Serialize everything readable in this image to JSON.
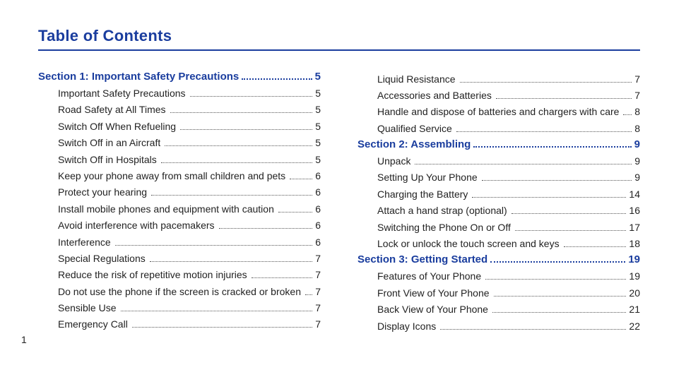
{
  "title": "Table of Contents",
  "pageNumber": "1",
  "columns": [
    [
      {
        "type": "section",
        "label": "Section 1:  Important Safety Precautions",
        "page": "5"
      },
      {
        "type": "entry",
        "label": "Important Safety Precautions",
        "page": "5"
      },
      {
        "type": "entry",
        "label": "Road Safety at All Times",
        "page": "5"
      },
      {
        "type": "entry",
        "label": "Switch Off When Refueling",
        "page": "5"
      },
      {
        "type": "entry",
        "label": "Switch Off in an Aircraft",
        "page": "5"
      },
      {
        "type": "entry",
        "label": "Switch Off in Hospitals",
        "page": "5"
      },
      {
        "type": "entry",
        "label": "Keep your phone away from small children and pets",
        "page": "6"
      },
      {
        "type": "entry",
        "label": "Protect your hearing",
        "page": "6"
      },
      {
        "type": "entry",
        "label": "Install mobile phones and equipment with caution",
        "page": "6"
      },
      {
        "type": "entry",
        "label": "Avoid interference with pacemakers",
        "page": "6"
      },
      {
        "type": "entry",
        "label": "Interference",
        "page": "6"
      },
      {
        "type": "entry",
        "label": "Special Regulations",
        "page": "7"
      },
      {
        "type": "entry",
        "label": "Reduce the risk of repetitive motion injuries",
        "page": "7"
      },
      {
        "type": "entry",
        "label": "Do not use the phone if the screen is cracked or broken",
        "page": "7"
      },
      {
        "type": "entry",
        "label": "Sensible Use",
        "page": "7"
      },
      {
        "type": "entry",
        "label": "Emergency Call",
        "page": "7"
      }
    ],
    [
      {
        "type": "entry",
        "label": "Liquid Resistance",
        "page": "7"
      },
      {
        "type": "entry",
        "label": "Accessories and Batteries",
        "page": "7"
      },
      {
        "type": "entry",
        "label": "Handle and dispose of batteries and chargers with care",
        "page": "8"
      },
      {
        "type": "entry",
        "label": "Qualified Service",
        "page": "8"
      },
      {
        "type": "section",
        "label": "Section 2:  Assembling",
        "page": "9"
      },
      {
        "type": "entry",
        "label": "Unpack",
        "page": "9"
      },
      {
        "type": "entry",
        "label": "Setting Up Your Phone",
        "page": "9"
      },
      {
        "type": "entry",
        "label": "Charging the Battery",
        "page": "14"
      },
      {
        "type": "entry",
        "label": "Attach a hand strap (optional)",
        "page": "16"
      },
      {
        "type": "entry",
        "label": "Switching the Phone On or Off",
        "page": "17"
      },
      {
        "type": "entry",
        "label": "Lock or unlock the touch screen and keys",
        "page": "18"
      },
      {
        "type": "section",
        "label": "Section 3:  Getting Started",
        "page": "19"
      },
      {
        "type": "entry",
        "label": "Features of Your Phone",
        "page": "19"
      },
      {
        "type": "entry",
        "label": "Front View of Your Phone",
        "page": "20"
      },
      {
        "type": "entry",
        "label": "Back View of Your Phone",
        "page": "21"
      },
      {
        "type": "entry",
        "label": "Display Icons",
        "page": "22"
      }
    ]
  ]
}
